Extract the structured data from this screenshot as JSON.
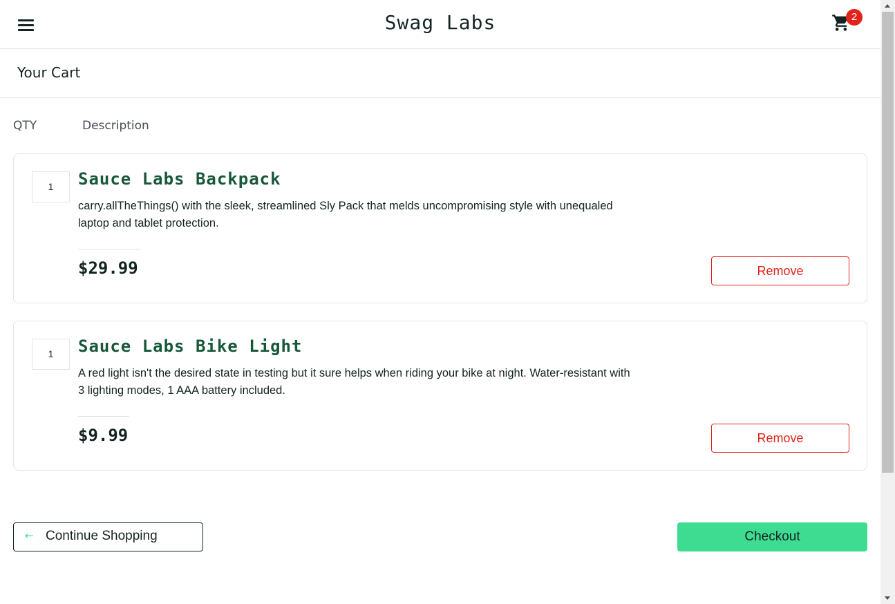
{
  "header": {
    "logo": "Swag Labs",
    "cart_count": "2"
  },
  "secondary": {
    "title": "Your Cart"
  },
  "list_header": {
    "qty": "QTY",
    "description": "Description"
  },
  "cart_items": [
    {
      "quantity": "1",
      "name": "Sauce Labs Backpack",
      "description": "carry.allTheThings() with the sleek, streamlined Sly Pack that melds uncompromising style with unequaled laptop and tablet protection.",
      "price": "$29.99",
      "remove_label": "Remove"
    },
    {
      "quantity": "1",
      "name": "Sauce Labs Bike Light",
      "description": "A red light isn't the desired state in testing but it sure helps when riding your bike at night. Water-resistant with 3 lighting modes, 1 AAA battery included.",
      "price": "$9.99",
      "remove_label": "Remove"
    }
  ],
  "footer": {
    "continue_label": "Continue Shopping",
    "continue_icon": "arrow-left-icon",
    "checkout_label": "Checkout"
  },
  "colors": {
    "accent": "#3ddc91",
    "remove": "#e2231a",
    "item_name": "#18583a",
    "badge": "#e2231a"
  }
}
